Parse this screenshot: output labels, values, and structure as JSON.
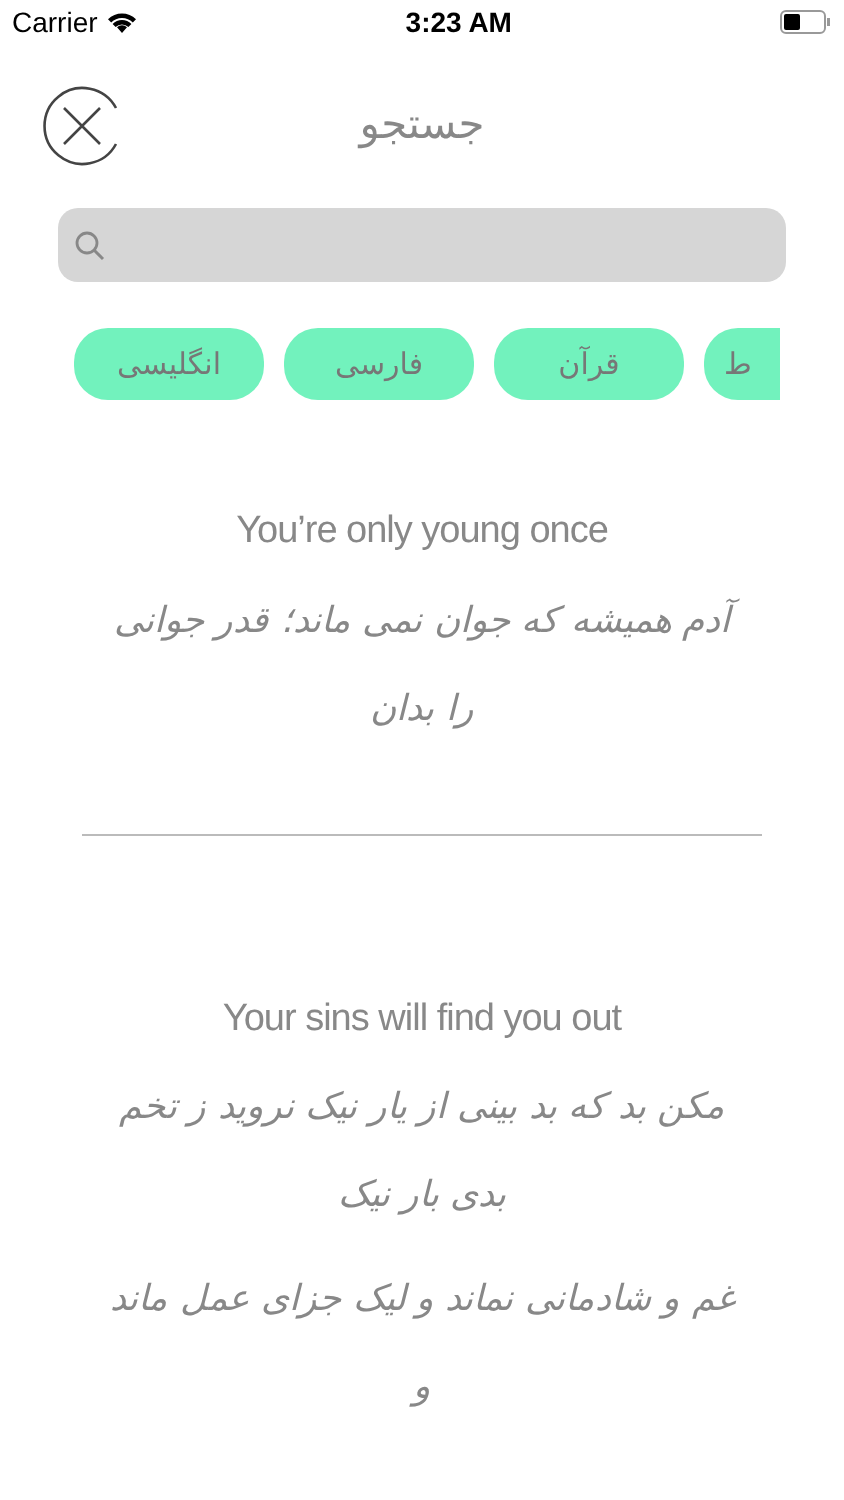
{
  "status_bar": {
    "carrier": "Carrier",
    "time": "3:23 AM"
  },
  "header": {
    "title": "جستجو"
  },
  "chips": [
    {
      "label": "ط"
    },
    {
      "label": "قرآن"
    },
    {
      "label": "فارسی"
    },
    {
      "label": "انگلیسی"
    }
  ],
  "proverbs": [
    {
      "english": "You’re only young once",
      "persian": [
        "آدم همیشه که جوان نمی ماند؛ قدر جوانی را بدان"
      ]
    },
    {
      "english": "Your sins will find you out",
      "persian": [
        "مکن بد که بد بینی از یار نیک      نروید ز تخم بدی بار نیک",
        "غم و شادمانی نماند و لیک      جزای عمل ماند و"
      ]
    }
  ]
}
